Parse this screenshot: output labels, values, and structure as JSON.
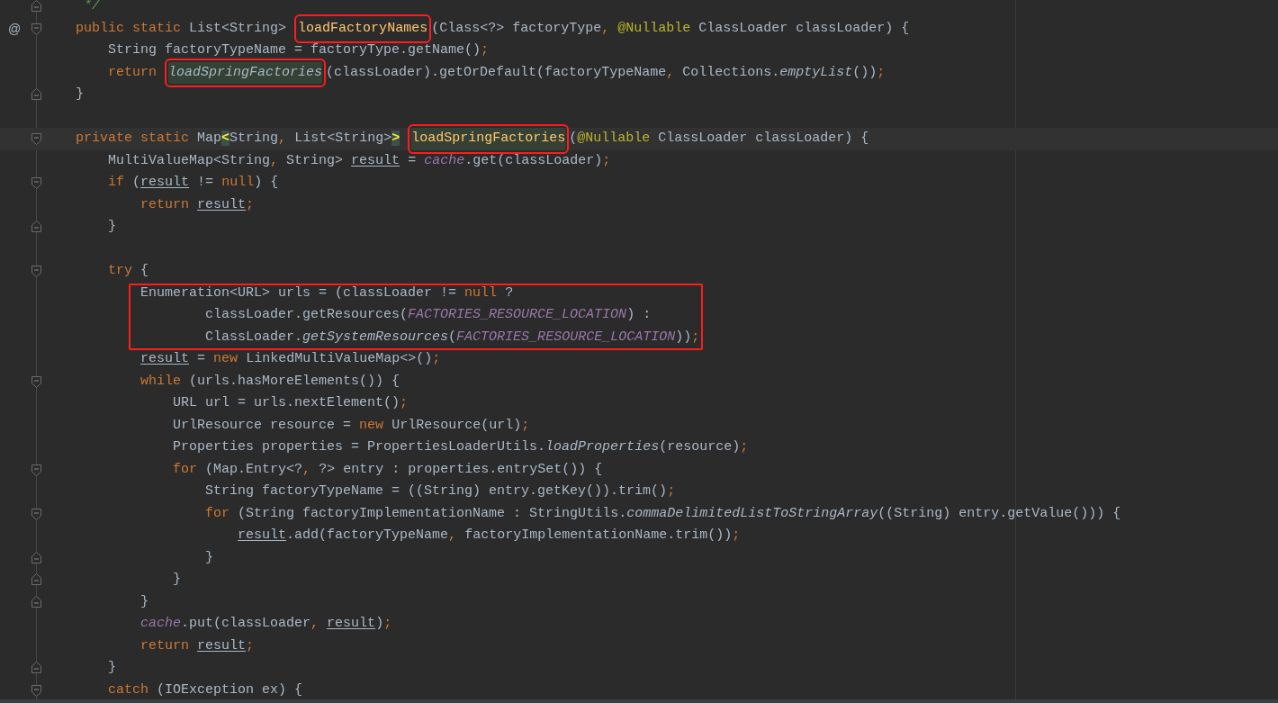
{
  "code": [
    {
      "kind": "fold_end",
      "tokens": [
        {
          "t": "     */",
          "kind": "comment"
        }
      ]
    },
    {
      "kind": "fold_start",
      "gutter_mark": "@",
      "tokens": [
        {
          "t": "    public static",
          "kind": "keyword"
        },
        {
          "t": " List<String>",
          "kind": "plain"
        },
        {
          "t": " loadFactoryNames",
          "kind": "declaration",
          "boxed": true
        },
        {
          "t": "(Class<?> factoryType",
          "kind": "plain"
        },
        {
          "t": ",",
          "kind": "keyword"
        },
        {
          "t": " @Nullable",
          "kind": "annotation"
        },
        {
          "t": " ClassLoader classLoader) {",
          "kind": "plain"
        }
      ]
    },
    {
      "kind": "plain",
      "tokens": [
        {
          "t": "        String factoryTypeName = factoryType.getName()",
          "kind": "plain"
        },
        {
          "t": ";",
          "kind": "keyword"
        }
      ]
    },
    {
      "kind": "plain",
      "tokens": [
        {
          "t": "        return",
          "kind": "keyword"
        },
        {
          "t": " loadSpringFactories",
          "kind": "static_call",
          "boxed": true,
          "highlighted": true
        },
        {
          "t": "(classLoader).getOrDefault(factoryTypeName",
          "kind": "plain"
        },
        {
          "t": ",",
          "kind": "keyword"
        },
        {
          "t": " Collections.",
          "kind": "plain"
        },
        {
          "t": "emptyList",
          "kind": "static_call"
        },
        {
          "t": "())",
          "kind": "plain"
        },
        {
          "t": ";",
          "kind": "keyword"
        }
      ]
    },
    {
      "kind": "fold_end",
      "tokens": [
        {
          "t": "    }",
          "kind": "plain"
        }
      ]
    },
    {
      "kind": "blank"
    },
    {
      "kind": "fold_start",
      "current": true,
      "tokens": [
        {
          "t": "    private static",
          "kind": "keyword"
        },
        {
          "t": " Map",
          "kind": "plain"
        },
        {
          "t": "<",
          "kind": "brace_match"
        },
        {
          "t": "String",
          "kind": "plain"
        },
        {
          "t": ",",
          "kind": "keyword"
        },
        {
          "t": " List<String>",
          "kind": "plain"
        },
        {
          "t": ">",
          "kind": "brace_match"
        },
        {
          "t": " loadSpringFactories",
          "kind": "declaration",
          "boxed": true,
          "highlighted": true
        },
        {
          "t": "(",
          "kind": "plain"
        },
        {
          "t": "@Nullable",
          "kind": "annotation"
        },
        {
          "t": " ClassLoader classLoader) {",
          "kind": "plain"
        }
      ]
    },
    {
      "kind": "plain",
      "tokens": [
        {
          "t": "        MultiValueMap<String",
          "kind": "plain"
        },
        {
          "t": ",",
          "kind": "keyword"
        },
        {
          "t": " String>",
          "kind": "plain"
        },
        {
          "t": " result",
          "kind": "reassigned"
        },
        {
          "t": " =",
          "kind": "plain"
        },
        {
          "t": " cache",
          "kind": "field"
        },
        {
          "t": ".get(classLoader)",
          "kind": "plain"
        },
        {
          "t": ";",
          "kind": "keyword"
        }
      ]
    },
    {
      "kind": "fold_start",
      "tokens": [
        {
          "t": "        if",
          "kind": "keyword"
        },
        {
          "t": " (",
          "kind": "plain"
        },
        {
          "t": "result",
          "kind": "reassigned"
        },
        {
          "t": " !=",
          "kind": "plain"
        },
        {
          "t": " null",
          "kind": "keyword"
        },
        {
          "t": ") {",
          "kind": "plain"
        }
      ]
    },
    {
      "kind": "plain",
      "tokens": [
        {
          "t": "            return",
          "kind": "keyword"
        },
        {
          "t": " result",
          "kind": "reassigned"
        },
        {
          "t": ";",
          "kind": "keyword"
        }
      ]
    },
    {
      "kind": "fold_end",
      "tokens": [
        {
          "t": "        }",
          "kind": "plain"
        }
      ]
    },
    {
      "kind": "blank"
    },
    {
      "kind": "fold_start",
      "tokens": [
        {
          "t": "        try",
          "kind": "keyword"
        },
        {
          "t": " {",
          "kind": "plain"
        }
      ]
    },
    {
      "kind": "group",
      "boxed": true,
      "lines": [
        {
          "tokens": [
            {
              "t": "            Enumeration<URL> urls = (classLoader !=",
              "kind": "plain"
            },
            {
              "t": " null",
              "kind": "keyword"
            },
            {
              "t": " ?",
              "kind": "plain"
            }
          ]
        },
        {
          "tokens": [
            {
              "t": "                    classLoader.getResources(",
              "kind": "plain"
            },
            {
              "t": "FACTORIES_RESOURCE_LOCATION",
              "kind": "field"
            },
            {
              "t": ") :",
              "kind": "plain"
            }
          ]
        },
        {
          "tokens": [
            {
              "t": "                    ClassLoader.",
              "kind": "plain"
            },
            {
              "t": "getSystemResources",
              "kind": "static_call"
            },
            {
              "t": "(",
              "kind": "plain"
            },
            {
              "t": "FACTORIES_RESOURCE_LOCATION",
              "kind": "field"
            },
            {
              "t": "))",
              "kind": "plain"
            },
            {
              "t": ";",
              "kind": "keyword"
            }
          ]
        }
      ]
    },
    {
      "kind": "plain",
      "tokens": [
        {
          "t": "            result",
          "kind": "reassigned"
        },
        {
          "t": " =",
          "kind": "plain"
        },
        {
          "t": " new",
          "kind": "keyword"
        },
        {
          "t": " LinkedMultiValueMap<>()",
          "kind": "plain"
        },
        {
          "t": ";",
          "kind": "keyword"
        }
      ]
    },
    {
      "kind": "fold_start",
      "tokens": [
        {
          "t": "            while",
          "kind": "keyword"
        },
        {
          "t": " (urls.hasMoreElements()) {",
          "kind": "plain"
        }
      ]
    },
    {
      "kind": "plain",
      "tokens": [
        {
          "t": "                URL url = urls.nextElement()",
          "kind": "plain"
        },
        {
          "t": ";",
          "kind": "keyword"
        }
      ]
    },
    {
      "kind": "plain",
      "tokens": [
        {
          "t": "                UrlResource resource =",
          "kind": "plain"
        },
        {
          "t": " new",
          "kind": "keyword"
        },
        {
          "t": " UrlResource(url)",
          "kind": "plain"
        },
        {
          "t": ";",
          "kind": "keyword"
        }
      ]
    },
    {
      "kind": "plain",
      "tokens": [
        {
          "t": "                Properties properties = PropertiesLoaderUtils.",
          "kind": "plain"
        },
        {
          "t": "loadProperties",
          "kind": "static_call"
        },
        {
          "t": "(resource)",
          "kind": "plain"
        },
        {
          "t": ";",
          "kind": "keyword"
        }
      ]
    },
    {
      "kind": "fold_start",
      "tokens": [
        {
          "t": "                for",
          "kind": "keyword"
        },
        {
          "t": " (Map.Entry<?",
          "kind": "plain"
        },
        {
          "t": ",",
          "kind": "keyword"
        },
        {
          "t": " ?> entry : properties.entrySet()) {",
          "kind": "plain"
        }
      ]
    },
    {
      "kind": "plain",
      "tokens": [
        {
          "t": "                    String factoryTypeName = ((String) entry.getKey()).trim()",
          "kind": "plain"
        },
        {
          "t": ";",
          "kind": "keyword"
        }
      ]
    },
    {
      "kind": "fold_start",
      "tokens": [
        {
          "t": "                    for",
          "kind": "keyword"
        },
        {
          "t": " (String factoryImplementationName : StringUtils.",
          "kind": "plain"
        },
        {
          "t": "commaDelimitedListToStringArray",
          "kind": "static_call"
        },
        {
          "t": "((String) entry.getValue())) {",
          "kind": "plain"
        }
      ]
    },
    {
      "kind": "plain",
      "tokens": [
        {
          "t": "                        result",
          "kind": "reassigned"
        },
        {
          "t": ".add(factoryTypeName",
          "kind": "plain"
        },
        {
          "t": ",",
          "kind": "keyword"
        },
        {
          "t": " factoryImplementationName.trim())",
          "kind": "plain"
        },
        {
          "t": ";",
          "kind": "keyword"
        }
      ]
    },
    {
      "kind": "fold_end",
      "tokens": [
        {
          "t": "                    }",
          "kind": "plain"
        }
      ]
    },
    {
      "kind": "fold_end",
      "tokens": [
        {
          "t": "                }",
          "kind": "plain"
        }
      ]
    },
    {
      "kind": "fold_end",
      "tokens": [
        {
          "t": "            }",
          "kind": "plain"
        }
      ]
    },
    {
      "kind": "plain",
      "tokens": [
        {
          "t": "            cache",
          "kind": "field"
        },
        {
          "t": ".put(classLoader",
          "kind": "plain"
        },
        {
          "t": ",",
          "kind": "keyword"
        },
        {
          "t": " result",
          "kind": "reassigned"
        },
        {
          "t": ")",
          "kind": "plain"
        },
        {
          "t": ";",
          "kind": "keyword"
        }
      ]
    },
    {
      "kind": "plain",
      "tokens": [
        {
          "t": "            return",
          "kind": "keyword"
        },
        {
          "t": " result",
          "kind": "reassigned"
        },
        {
          "t": ";",
          "kind": "keyword"
        }
      ]
    },
    {
      "kind": "fold_end",
      "tokens": [
        {
          "t": "        }",
          "kind": "plain"
        }
      ]
    },
    {
      "kind": "fold_start",
      "tokens": [
        {
          "t": "        catch",
          "kind": "keyword"
        },
        {
          "t": " (IOException ex) {",
          "kind": "plain"
        }
      ]
    }
  ]
}
